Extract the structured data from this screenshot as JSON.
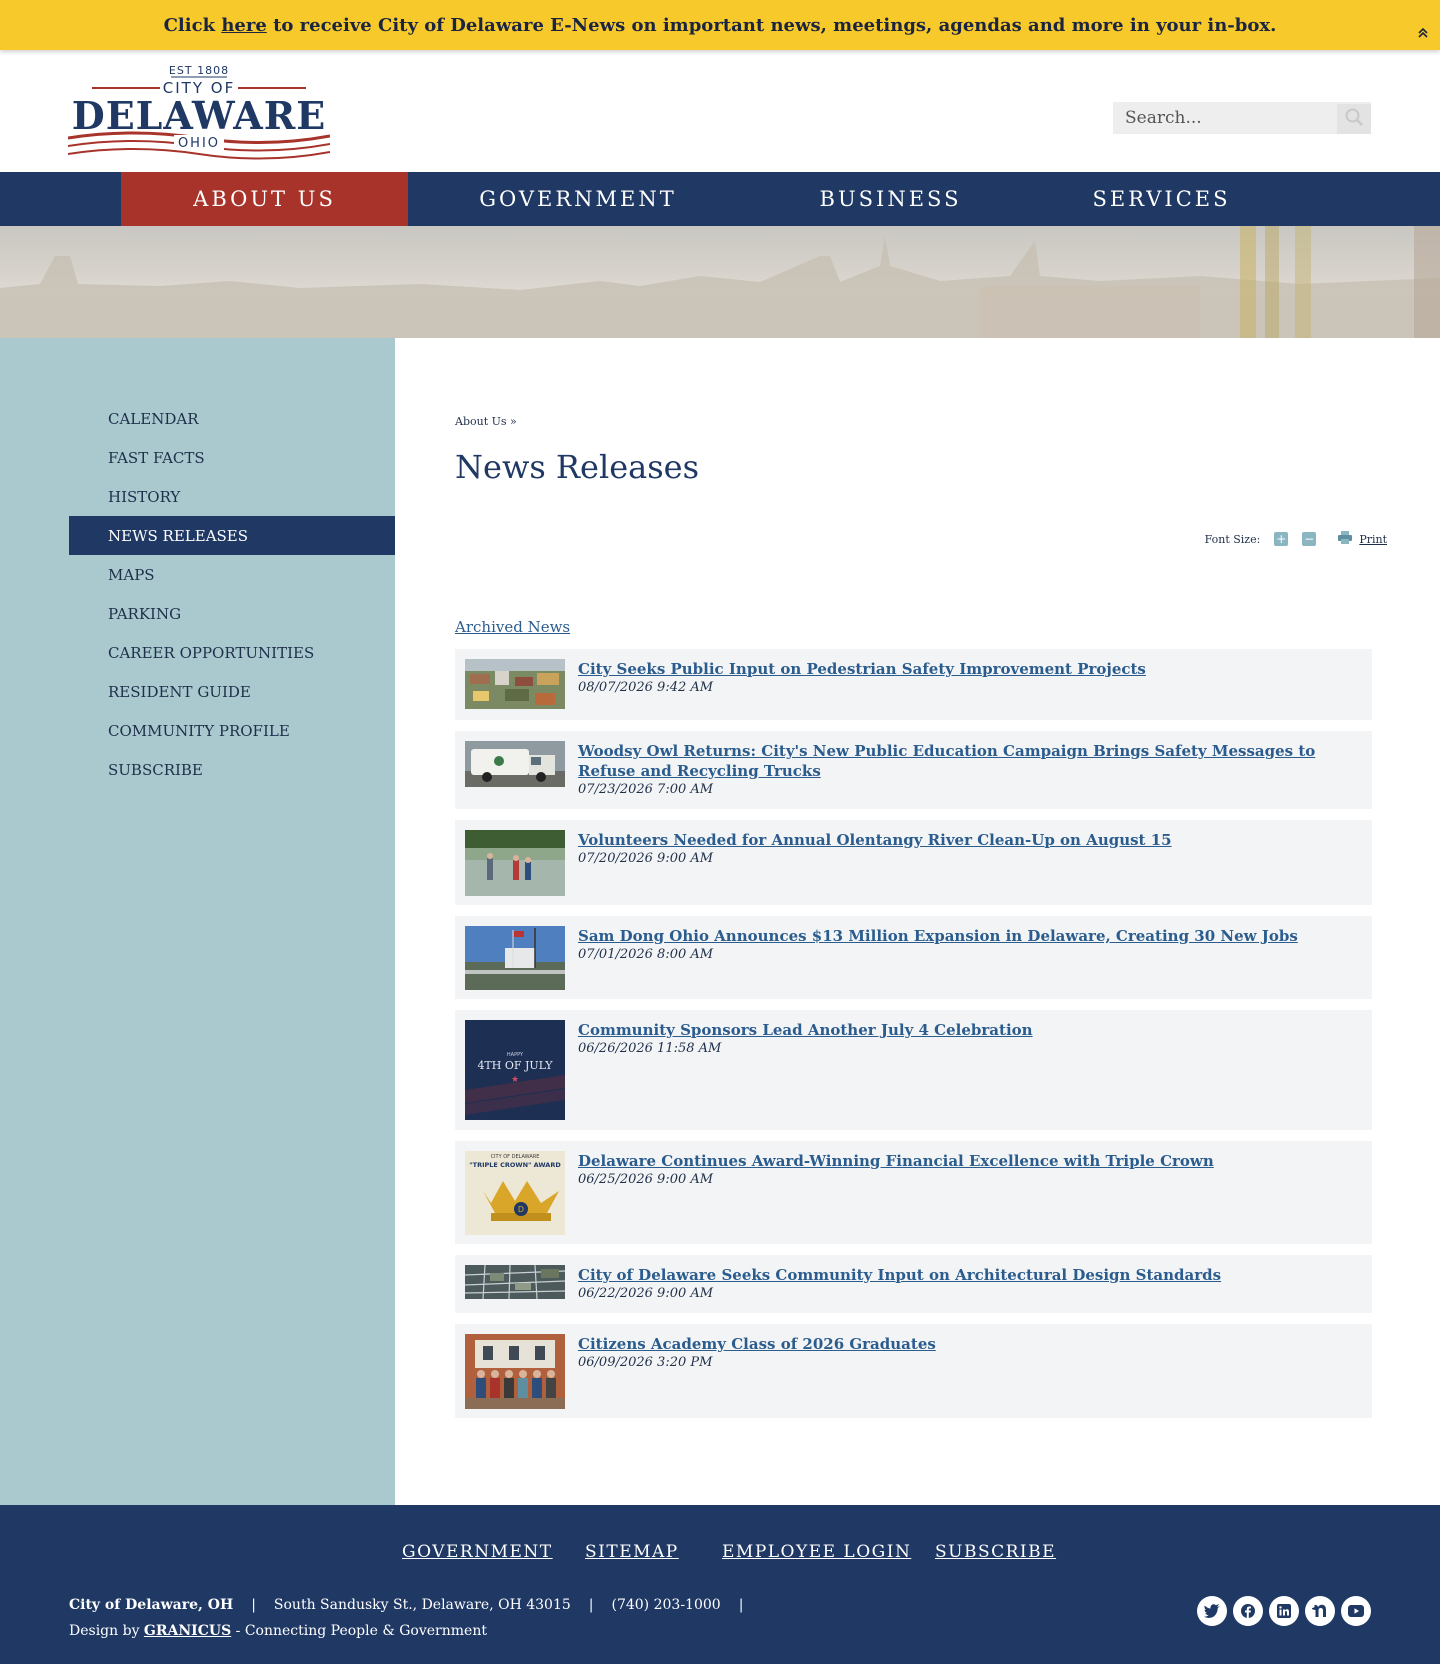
{
  "alert": {
    "prefix": "Click ",
    "link": "here",
    "suffix": " to receive City of Delaware E-News on important news, meetings, agendas and more in your in-box."
  },
  "logo": {
    "est": "EST 1808",
    "city_of": "CITY OF",
    "name": "DELAWARE",
    "state": "OHIO"
  },
  "search": {
    "placeholder": "Search..."
  },
  "nav": {
    "items": [
      {
        "label": "ABOUT US",
        "active": true
      },
      {
        "label": "GOVERNMENT",
        "active": false
      },
      {
        "label": "BUSINESS",
        "active": false
      },
      {
        "label": "SERVICES",
        "active": false
      }
    ]
  },
  "sidebar": {
    "items": [
      {
        "label": "CALENDAR"
      },
      {
        "label": "FAST FACTS"
      },
      {
        "label": "HISTORY"
      },
      {
        "label": "NEWS RELEASES",
        "active": true
      },
      {
        "label": "MAPS"
      },
      {
        "label": "PARKING"
      },
      {
        "label": "CAREER OPPORTUNITIES"
      },
      {
        "label": "RESIDENT GUIDE"
      },
      {
        "label": "COMMUNITY PROFILE"
      },
      {
        "label": "SUBSCRIBE"
      }
    ]
  },
  "main": {
    "breadcrumb": "About Us »",
    "title": "News Releases",
    "tools": {
      "font_size_label": "Font Size:",
      "increase": "+",
      "decrease": "−",
      "print": "Print"
    },
    "archived_link": "Archived News",
    "news": [
      {
        "title": "City Seeks Public Input on Pedestrian Safety Improvement Projects",
        "date": "08/07/2026 9:42 AM",
        "thumb": "aerial-town-photo"
      },
      {
        "title": "Woodsy Owl Returns: City's New Public Education Campaign Brings Safety Messages to Refuse and Recycling Trucks",
        "date": "07/23/2026 7:00 AM",
        "thumb": "refuse-truck-photo"
      },
      {
        "title": "Volunteers Needed for Annual Olentangy River Clean-Up on August 15",
        "date": "07/20/2026 9:00 AM",
        "thumb": "river-cleanup-photo"
      },
      {
        "title": "Sam Dong Ohio Announces $13 Million Expansion in Delaware, Creating 30 New Jobs",
        "date": "07/01/2026 8:00 AM",
        "thumb": "factory-flags-photo"
      },
      {
        "title": "Community Sponsors Lead Another July 4 Celebration",
        "date": "06/26/2026 11:58 AM",
        "thumb": "fourth-of-july-graphic",
        "thumb_text": "4TH OF JULY",
        "thumb_small": "HAPPY"
      },
      {
        "title": "Delaware Continues Award-Winning Financial Excellence with Triple Crown",
        "date": "06/25/2026 9:00 AM",
        "thumb": "triple-crown-graphic",
        "thumb_text": "\"TRIPLE CROWN\" AWARD",
        "thumb_small": "CITY OF DELAWARE"
      },
      {
        "title": "City of Delaware Seeks Community Input on Architectural Design Standards",
        "date": "06/22/2026 9:00 AM",
        "thumb": "aerial-map-photo"
      },
      {
        "title": "Citizens Academy Class of 2026 Graduates",
        "date": "06/09/2026 3:20 PM",
        "thumb": "group-photo"
      }
    ]
  },
  "footer": {
    "links": [
      {
        "label": "GOVERNMENT"
      },
      {
        "label": "SITEMAP"
      },
      {
        "label": "EMPLOYEE LOGIN"
      },
      {
        "label": "SUBSCRIBE"
      }
    ],
    "org": "City of Delaware, OH",
    "address": "South Sandusky St., Delaware, OH 43015",
    "phone": "(740) 203-1000",
    "separator": "|",
    "design_prefix": "Design by ",
    "design_link": "GRANICUS",
    "design_suffix": " - Connecting People & Government",
    "socials": [
      "twitter-icon",
      "facebook-icon",
      "linkedin-icon",
      "nextdoor-icon",
      "youtube-icon"
    ]
  },
  "colors": {
    "alert": "#f8c92b",
    "navy": "#1f3864",
    "active_red": "#a8332a",
    "sidebar": "#a9c9cf",
    "link_blue": "#2b5c8e",
    "news_bg": "#f3f4f5"
  }
}
